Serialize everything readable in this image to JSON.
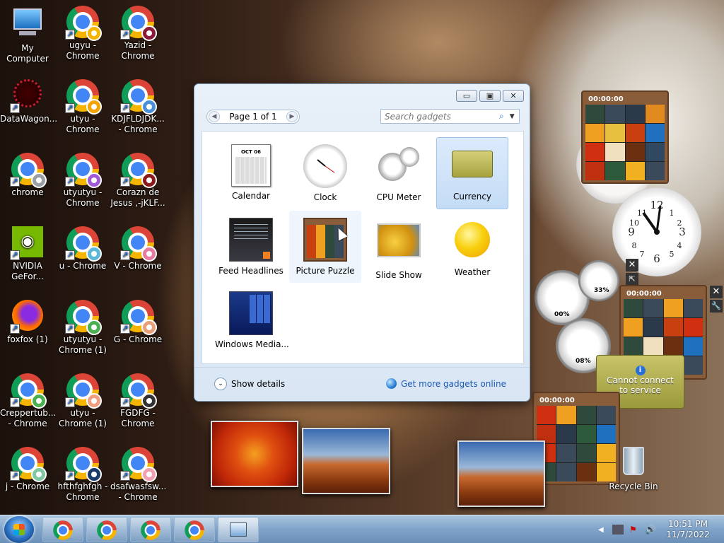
{
  "desktop_icons": [
    {
      "label": "My Computer",
      "type": "computer"
    },
    {
      "label": "ugyu -\nChrome",
      "type": "chrome",
      "avatar": "#f4b400"
    },
    {
      "label": "Yazid -\nChrome",
      "type": "chrome",
      "avatar": "#8b1a3a"
    },
    {
      "label": "DataWagon...",
      "type": "app"
    },
    {
      "label": "utyu -\nChrome",
      "type": "chrome",
      "avatar": "#f4a300"
    },
    {
      "label": "KDJFLDJDK...\n- Chrome",
      "type": "chrome",
      "avatar": "#4a90d9"
    },
    {
      "label": "chrome",
      "type": "chrome",
      "avatar": "#9aa0a6"
    },
    {
      "label": "utyutyu -\nChrome",
      "type": "chrome",
      "avatar": "#a259d9"
    },
    {
      "label": "Corazn de\nJesus ,-jKLF...",
      "type": "chrome",
      "avatar": "#8b1a1a"
    },
    {
      "label": "NVIDIA\nGeFor...",
      "type": "nvidia"
    },
    {
      "label": "u - Chrome",
      "type": "chrome",
      "avatar": "#5bb8d9"
    },
    {
      "label": "V - Chrome",
      "type": "chrome",
      "avatar": "#e67aa0"
    },
    {
      "label": "foxfox (1)",
      "type": "firefox"
    },
    {
      "label": "utyutyu -\nChrome (1)",
      "type": "chrome",
      "avatar": "#4caf50"
    },
    {
      "label": "G - Chrome",
      "type": "chrome",
      "avatar": "#e8a07a"
    },
    {
      "label": "Creppertub...\n- Chrome",
      "type": "chrome",
      "avatar": "#4caf50"
    },
    {
      "label": "utyu -\nChrome (1)",
      "type": "chrome",
      "avatar": "#f0a080"
    },
    {
      "label": "FGDFG -\nChrome",
      "type": "chrome",
      "avatar": "#333333"
    },
    {
      "label": "j - Chrome",
      "type": "chrome",
      "avatar": "#80c9a0"
    },
    {
      "label": "hfthfghfgh -\nChrome",
      "type": "chrome",
      "avatar": "#1a3a6b"
    },
    {
      "label": "dsafwasfsw...\n- Chrome",
      "type": "chrome",
      "avatar": "#f0a0b0"
    }
  ],
  "gadget_window": {
    "pager_label": "Page 1 of 1",
    "search_placeholder": "Search gadgets",
    "gadgets": [
      {
        "name": "Calendar"
      },
      {
        "name": "Clock"
      },
      {
        "name": "CPU Meter"
      },
      {
        "name": "Currency",
        "selected": true
      },
      {
        "name": "Feed Headlines"
      },
      {
        "name": "Picture Puzzle",
        "hover": true
      },
      {
        "name": "Slide Show"
      },
      {
        "name": "Weather"
      },
      {
        "name": "Windows Media..."
      }
    ],
    "calendar_month": "OCT 06",
    "show_details": "Show details",
    "get_more": "Get more gadgets online"
  },
  "widgets": {
    "puzzle_timer": "00:00:00",
    "cpu_percent_1": "00%",
    "cpu_percent_2": "33%",
    "cpu_percent_3": "08%",
    "currency_msg": "Cannot connect\nto service"
  },
  "recycle_bin": "Recycle Bin",
  "taskbar": {
    "time": "10:51 PM",
    "date": "11/7/2022"
  }
}
